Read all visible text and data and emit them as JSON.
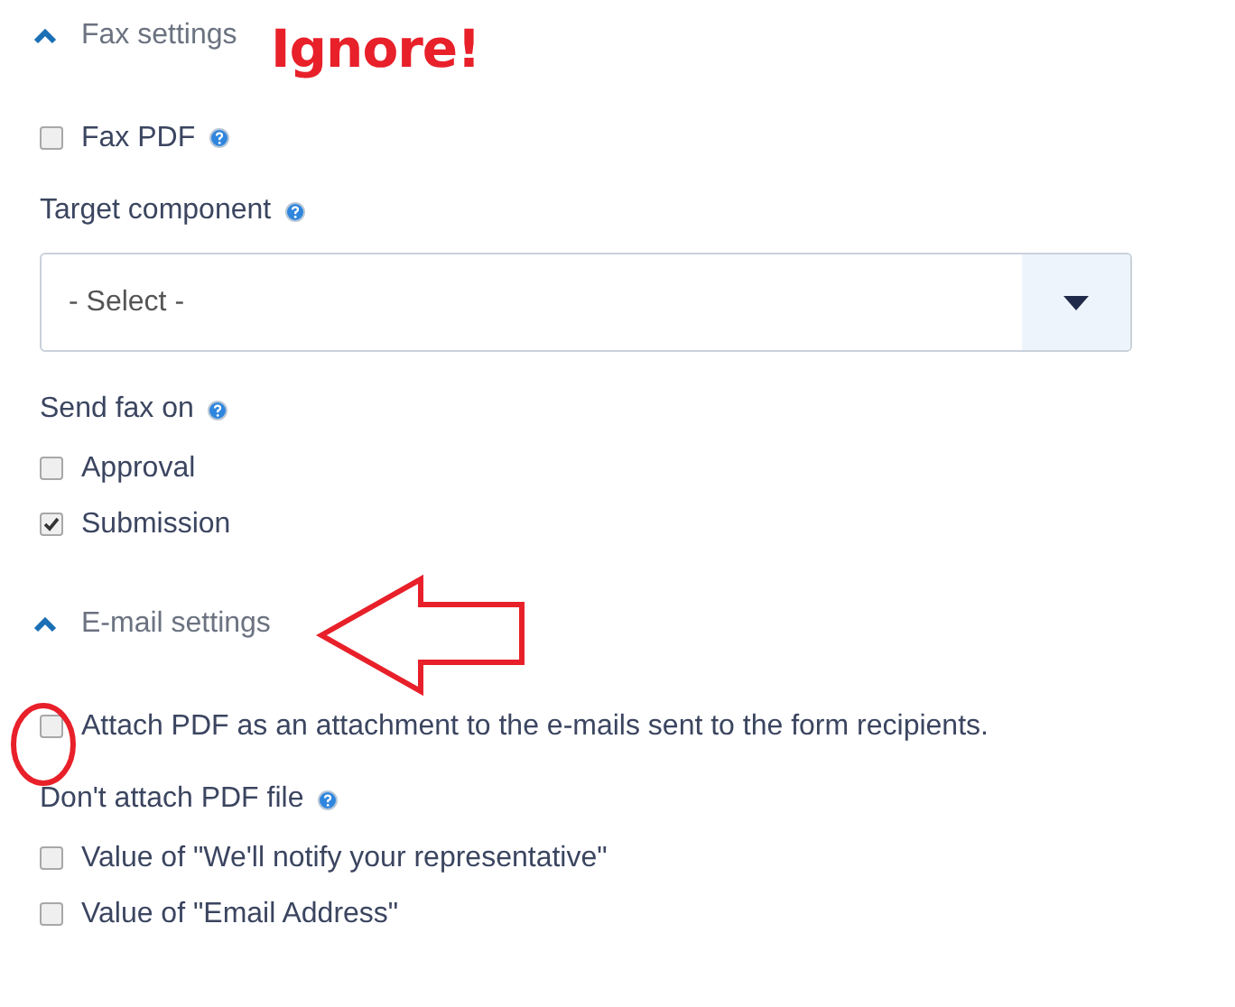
{
  "sections": [
    {
      "title": "Fax settings",
      "expanded": true,
      "items": [
        {
          "kind": "checkbox",
          "label": "Fax PDF",
          "checked": false,
          "help": true
        },
        {
          "kind": "label",
          "label": "Target component",
          "help": true
        },
        {
          "kind": "select",
          "value": "- Select -"
        },
        {
          "kind": "label",
          "label": "Send fax on",
          "help": true
        },
        {
          "kind": "checkbox",
          "label": "Approval",
          "checked": false,
          "help": false
        },
        {
          "kind": "checkbox",
          "label": "Submission",
          "checked": true,
          "help": false
        }
      ]
    },
    {
      "title": "E-mail settings",
      "expanded": true,
      "items": [
        {
          "kind": "checkbox",
          "label": "Attach PDF as an attachment to the e-mails sent to the form recipients.",
          "checked": false,
          "help": false
        },
        {
          "kind": "label",
          "label": "Don't attach PDF file",
          "help": true
        },
        {
          "kind": "checkbox",
          "label": "Value of \"We'll notify your representative\"",
          "checked": false,
          "help": false
        },
        {
          "kind": "checkbox",
          "label": "Value of \"Email Address\"",
          "checked": false,
          "help": false
        }
      ]
    }
  ],
  "annotations": [
    {
      "kind": "text",
      "text": "Ignore!"
    },
    {
      "kind": "arrow"
    },
    {
      "kind": "circle"
    }
  ]
}
